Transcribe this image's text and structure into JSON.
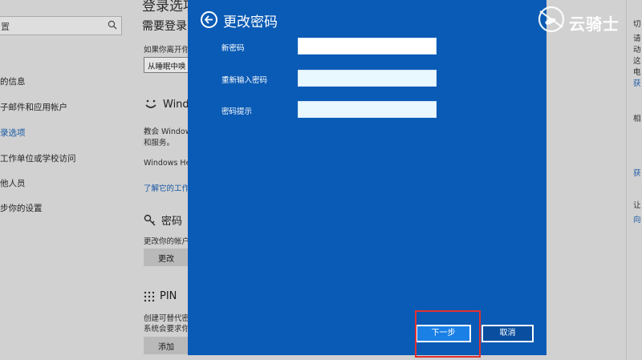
{
  "background": {
    "search": {
      "value": "置"
    },
    "nav_items": [
      {
        "label": "的信息",
        "active": false
      },
      {
        "label": "子邮件和应用帐户",
        "active": false
      },
      {
        "label": "录选项",
        "active": true
      },
      {
        "label": "工作单位或学校访问",
        "active": false
      },
      {
        "label": "他人员",
        "active": false
      },
      {
        "label": "步你的设置",
        "active": false
      }
    ],
    "section": {
      "heading": "登录选项",
      "subheading": "需要登录",
      "desc": "如果你离开你",
      "select_value": "从睡眠中唤",
      "hello_title": "Wind",
      "hello_desc1": "教会 Window",
      "hello_desc2": "和服务。",
      "hello_desc3": "Windows He",
      "hello_link": "了解它的工作",
      "password_title": "密码",
      "password_desc": "更改你的帐户",
      "password_button": "更改",
      "pin_title": "PIN",
      "pin_desc1": "创建可替代密",
      "pin_desc2": "系统会要求你",
      "pin_button": "添加"
    },
    "right_panel": {
      "lines": [
        "切",
        "请",
        "动",
        "这",
        "电",
        "获",
        "相",
        "获",
        "让",
        "向"
      ]
    }
  },
  "dialog": {
    "title": "更改密码",
    "fields": [
      {
        "label": "新密码",
        "value": ""
      },
      {
        "label": "重新输入密码",
        "value": ""
      },
      {
        "label": "密码提示",
        "value": ""
      }
    ],
    "next_label": "下一步",
    "cancel_label": "取消"
  },
  "watermark": {
    "text": "云骑士"
  },
  "colors": {
    "dialog_bg": "#0a5bb5",
    "next_button": "#1a80e6",
    "highlight": "#e03030",
    "link": "#1a62b8"
  }
}
